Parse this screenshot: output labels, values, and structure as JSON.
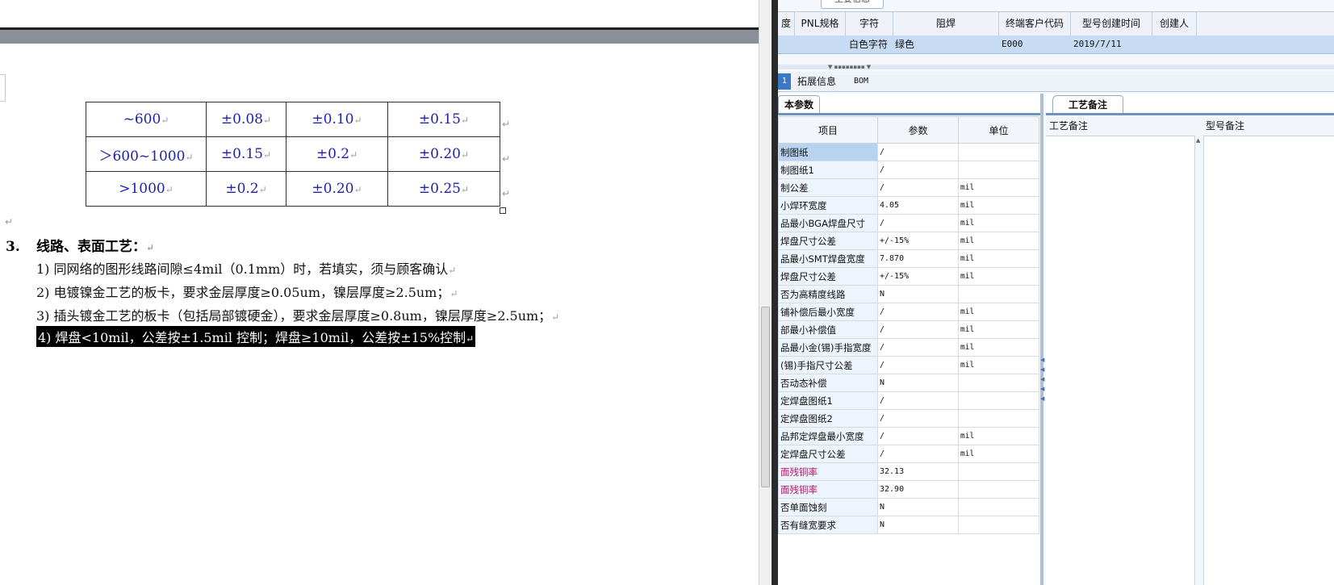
{
  "doc": {
    "tolerance_table": [
      [
        "~600",
        "±0.08",
        "±0.10",
        "±0.15"
      ],
      [
        "＞600~1000",
        "±0.15",
        "±0.2",
        "±0.20"
      ],
      [
        ">1000",
        "±0.2",
        "±0.20",
        "±0.25"
      ]
    ],
    "para_mark": "↵",
    "section": {
      "number": "3.",
      "title": "线路、表面工艺："
    },
    "lines": [
      "1)  同网络的图形线路间隙≤4mil（0.1mm）时，若填实，须与顾客确认",
      "2)  电镀镍金工艺的板卡，要求金层厚度≥0.05um，镍层厚度≥2.5um；",
      "3)  插头镀金工艺的板卡（包括局部镀硬金），要求金层厚度≥0.8um，镍层厚度≥2.5um；",
      "4) 焊盘<10mil，公差按±1.5mil 控制；焊盘≥10mil，公差按±15%控制"
    ]
  },
  "app": {
    "top_tab": "主要信息",
    "grid_headers": [
      "度",
      "PNL规格",
      "字符",
      "阻焊",
      "终端客户代码",
      "型号创建时间",
      "创建人"
    ],
    "grid_row": {
      "character": "白色字符",
      "solder_mask": "绿色",
      "customer_code": "E000",
      "created": "2019/7/11"
    },
    "sub_tabs": {
      "selected": "1",
      "ext_info": "拓展信息",
      "bom": "BOM"
    },
    "param_tab": "本参数",
    "param_headers": [
      "项目",
      "参数",
      "单位"
    ],
    "params": [
      {
        "item": "制图纸",
        "value": "/",
        "unit": ""
      },
      {
        "item": "制图纸1",
        "value": "/",
        "unit": ""
      },
      {
        "item": "制公差",
        "value": "/",
        "unit": "mil"
      },
      {
        "item": "小焊环宽度",
        "value": "4.05",
        "unit": "mil"
      },
      {
        "item": "品最小BGA焊盘尺寸",
        "value": "/",
        "unit": "mil"
      },
      {
        "item": "焊盘尺寸公差",
        "value": "+/-15%",
        "unit": "mil"
      },
      {
        "item": "品最小SMT焊盘宽度",
        "value": "7.870",
        "unit": "mil"
      },
      {
        "item": "焊盘尺寸公差",
        "value": "+/-15%",
        "unit": "mil"
      },
      {
        "item": "否为高精度线路",
        "value": "N",
        "unit": ""
      },
      {
        "item": "铺补偿后最小宽度",
        "value": "/",
        "unit": "mil"
      },
      {
        "item": "部最小补偿值",
        "value": "/",
        "unit": "mil"
      },
      {
        "item": "品最小金(锡)手指宽度",
        "value": "/",
        "unit": "mil"
      },
      {
        "item": "(锡)手指尺寸公差",
        "value": "/",
        "unit": "mil"
      },
      {
        "item": "否动态补偿",
        "value": "N",
        "unit": ""
      },
      {
        "item": "定焊盘图纸1",
        "value": "/",
        "unit": ""
      },
      {
        "item": "定焊盘图纸2",
        "value": "/",
        "unit": ""
      },
      {
        "item": "品邦定焊盘最小宽度",
        "value": "/",
        "unit": "mil"
      },
      {
        "item": "定焊盘尺寸公差",
        "value": "/",
        "unit": "mil"
      },
      {
        "item": "面残铜率",
        "value": "32.13",
        "unit": ""
      },
      {
        "item": "面残铜率",
        "value": "32.90",
        "unit": ""
      },
      {
        "item": "否单面蚀刻",
        "value": "N",
        "unit": ""
      },
      {
        "item": "否有缝宽要求",
        "value": "N",
        "unit": ""
      }
    ],
    "remark_tab": "工艺备注",
    "remark_headers": [
      "工艺备注",
      "型号备注"
    ],
    "colors": {
      "selection_blue": "#c7dcf2",
      "tab_strip": "#6d93c4",
      "magenta_label": "#b0186a"
    }
  }
}
